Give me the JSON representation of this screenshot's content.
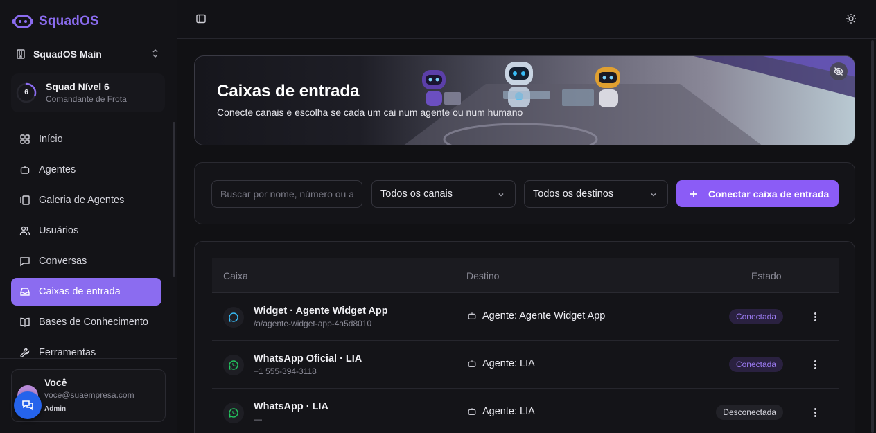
{
  "brand": {
    "name": "SquadOS",
    "accent": "#8b6cf0"
  },
  "workspace": {
    "name": "SquadOS Main"
  },
  "level": {
    "number": "6",
    "title": "Squad Nível 6",
    "subtitle": "Comandante de Frota",
    "progress": 0.3
  },
  "sidebar": {
    "items": [
      {
        "label": "Início",
        "icon": "grid-icon",
        "active": false
      },
      {
        "label": "Agentes",
        "icon": "bot-icon",
        "active": false
      },
      {
        "label": "Galeria de Agentes",
        "icon": "gallery-icon",
        "active": false
      },
      {
        "label": "Usuários",
        "icon": "users-icon",
        "active": false
      },
      {
        "label": "Conversas",
        "icon": "chat-icon",
        "active": false
      },
      {
        "label": "Caixas de entrada",
        "icon": "inbox-icon",
        "active": true
      },
      {
        "label": "Bases de Conhecimento",
        "icon": "book-icon",
        "active": false
      },
      {
        "label": "Ferramentas",
        "icon": "wrench-icon",
        "active": false
      }
    ]
  },
  "user": {
    "name": "Você",
    "email": "voce@suaempresa.com",
    "role": "Admin"
  },
  "banner": {
    "title": "Caixas de entrada",
    "subtitle": "Conecte canais e escolha se cada um cai num agente ou num humano"
  },
  "filters": {
    "search_placeholder": "Buscar por nome, número ou a",
    "channel_select": "Todos os canais",
    "destination_select": "Todos os destinos",
    "connect_button": "Conectar caixa de entrada"
  },
  "table": {
    "headers": {
      "caixa": "Caixa",
      "destino": "Destino",
      "estado": "Estado"
    },
    "rows": [
      {
        "icon": "message-circle-icon",
        "title": "Widget · Agente Widget App",
        "subtitle": "/a/agente-widget-app-4a5d8010",
        "destination": "Agente: Agente Widget App",
        "status": "Conectada",
        "connected": true
      },
      {
        "icon": "whatsapp-icon",
        "title": "WhatsApp Oficial · LIA",
        "subtitle": "+1 555-394-3118",
        "destination": "Agente: LIA",
        "status": "Conectada",
        "connected": true
      },
      {
        "icon": "whatsapp-icon",
        "title": "WhatsApp · LIA",
        "subtitle": "—",
        "destination": "Agente: LIA",
        "status": "Desconectada",
        "connected": false
      }
    ]
  }
}
